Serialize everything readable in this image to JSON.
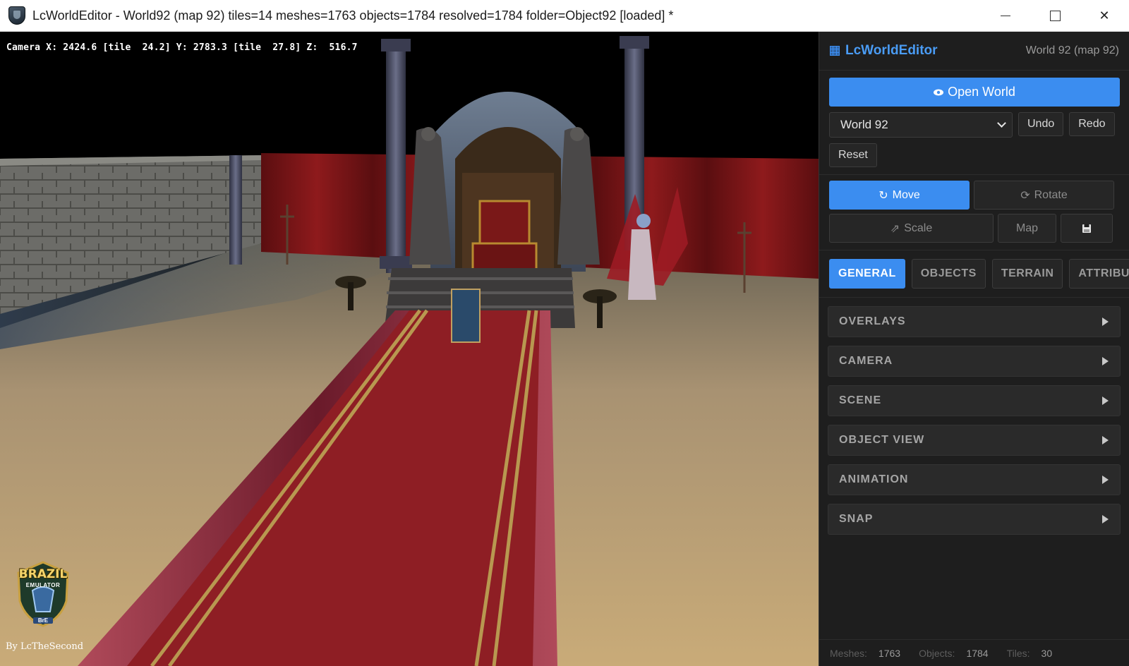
{
  "window": {
    "title": "LcWorldEditor - World92 (map 92) tiles=14 meshes=1763 objects=1784 resolved=1784 folder=Object92 [loaded] *",
    "close_glyph": "✕"
  },
  "viewport": {
    "camera_readout": "Camera X: 2424.6 [tile  24.2] Y: 2783.3 [tile  27.8] Z:  516.7",
    "logo_text": "BRAZIL",
    "logo_sub": "EMULATOR",
    "logo_tag": "BrE",
    "credit": "By LcTheSecond"
  },
  "panel": {
    "brand": "LcWorldEditor",
    "world_label": "World 92 (map 92)",
    "open_button": "Open World",
    "world_select": "World 92",
    "undo": "Undo",
    "redo": "Redo",
    "reset": "Reset",
    "tools": {
      "move": "Move",
      "rotate": "Rotate",
      "scale": "Scale",
      "map": "Map",
      "move_glyph": "↻",
      "rotate_glyph": "⟳",
      "scale_glyph": "⇗"
    },
    "tabs": [
      "GENERAL",
      "OBJECTS",
      "TERRAIN",
      "ATTRIBUTES"
    ],
    "sections": [
      "OVERLAYS",
      "CAMERA",
      "SCENE",
      "OBJECT VIEW",
      "ANIMATION",
      "SNAP"
    ],
    "status": {
      "meshes_label": "Meshes:",
      "meshes": "1763",
      "objects_label": "Objects:",
      "objects": "1784",
      "tiles_label": "Tiles:",
      "tiles": "30"
    }
  },
  "colors": {
    "accent": "#3b8df0",
    "panel_bg": "#1e1e1e",
    "carpet": "#8a1c1c",
    "sand": "#b89a6a"
  }
}
